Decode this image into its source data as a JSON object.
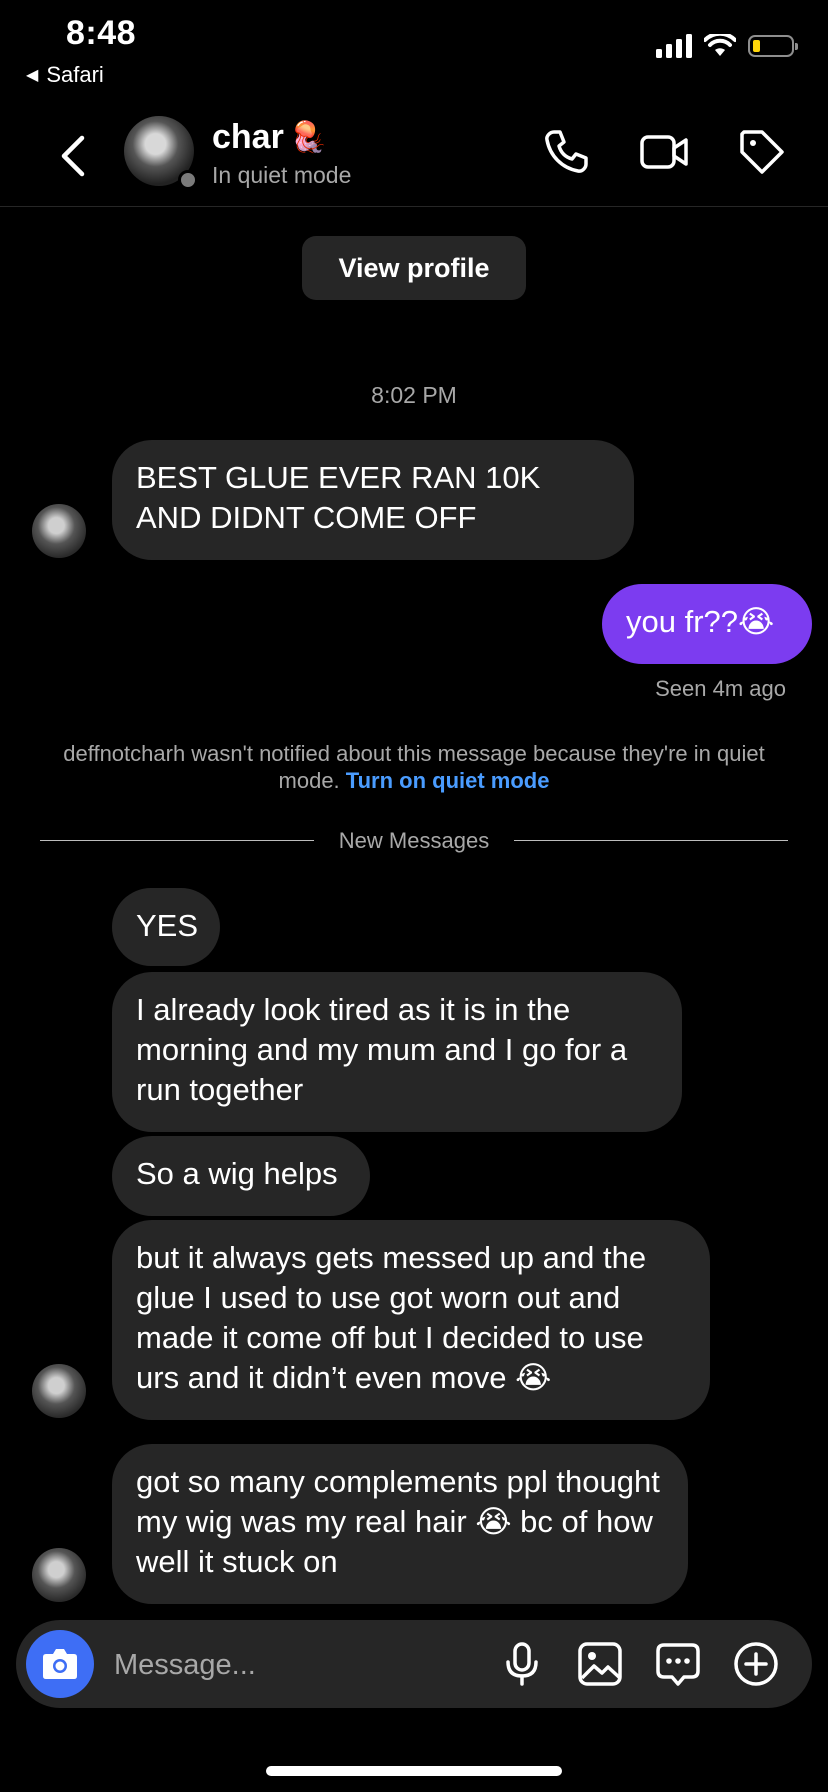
{
  "status_bar": {
    "time": "8:48",
    "back_app": "Safari"
  },
  "header": {
    "name": "char",
    "name_emoji": "🪼",
    "subtitle": "In quiet mode"
  },
  "view_profile_label": "View profile",
  "timestamp": "8:02 PM",
  "messages": [
    {
      "direction": "in",
      "text": "BEST GLUE EVER RAN 10K AND DIDNT COME OFF"
    },
    {
      "direction": "out",
      "text": "you fr??😭"
    },
    {
      "direction": "in",
      "text": "YES"
    },
    {
      "direction": "in",
      "text": "I already look tired as it is in the morning and my mum and I go for a run together"
    },
    {
      "direction": "in",
      "text": "So a wig helps"
    },
    {
      "direction": "in",
      "text": "but it always gets messed up and the glue I used to use got worn out and made it come off but I decided to use urs and it didn’t even move 😭"
    },
    {
      "direction": "in",
      "text": "got so many complements ppl thought my wig was my real hair 😭 bc of how well it stuck on"
    }
  ],
  "seen_label": "Seen 4m ago",
  "notice": {
    "text": "deffnotcharh wasn't notified about this message because they're in quiet mode.",
    "link": "Turn on quiet mode"
  },
  "divider_label": "New Messages",
  "composer": {
    "placeholder": "Message..."
  },
  "colors": {
    "outgoing_bubble": "#7c3cf0",
    "incoming_bubble": "#262626",
    "link": "#4a9cff",
    "camera_button": "#3e6ef5"
  },
  "icons": [
    "back-chevron-icon",
    "phone-icon",
    "video-camera-icon",
    "tag-icon",
    "camera-icon",
    "microphone-icon",
    "image-icon",
    "sticker-chat-icon",
    "plus-circle-icon"
  ]
}
